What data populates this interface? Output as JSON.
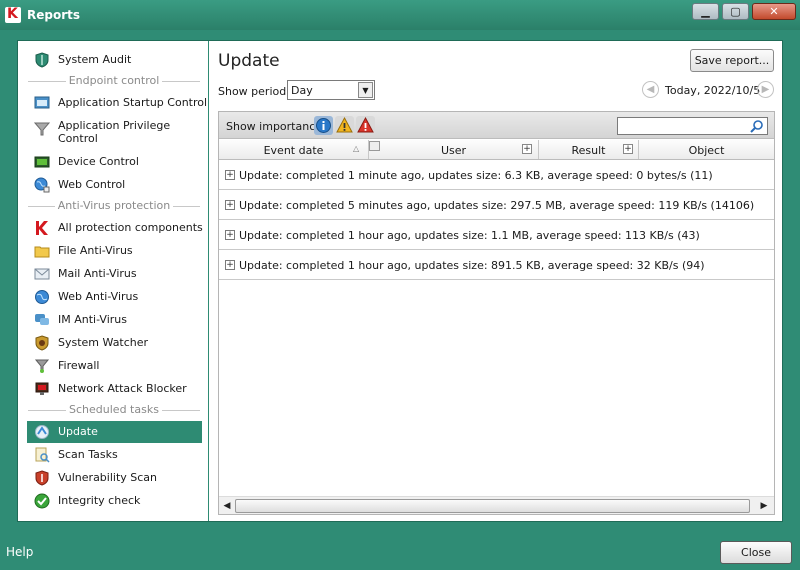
{
  "window": {
    "title": "Reports",
    "controls": {
      "minimize": "▁",
      "maximize": "▢",
      "close": "✕"
    }
  },
  "sidebar": {
    "items_top": [
      {
        "label": "System Audit",
        "icon": "shield-icon"
      }
    ],
    "section_endpoint": "Endpoint control",
    "items_endpoint": [
      {
        "label": "Application Startup Control",
        "icon": "app-window-icon"
      },
      {
        "label": "Application Privilege Control",
        "icon": "funnel-icon"
      },
      {
        "label": "Device Control",
        "icon": "device-icon"
      },
      {
        "label": "Web Control",
        "icon": "globe-icon"
      }
    ],
    "section_antivirus": "Anti-Virus protection",
    "items_antivirus": [
      {
        "label": "All protection components",
        "icon": "kaspersky-icon"
      },
      {
        "label": "File Anti-Virus",
        "icon": "folder-icon"
      },
      {
        "label": "Mail Anti-Virus",
        "icon": "envelope-icon"
      },
      {
        "label": "Web Anti-Virus",
        "icon": "globe-icon"
      },
      {
        "label": "IM Anti-Virus",
        "icon": "chat-icon"
      },
      {
        "label": "System Watcher",
        "icon": "shield-watch-icon"
      },
      {
        "label": "Firewall",
        "icon": "firewall-icon"
      },
      {
        "label": "Network Attack Blocker",
        "icon": "network-icon"
      }
    ],
    "section_tasks": "Scheduled tasks",
    "items_tasks": [
      {
        "label": "Update",
        "icon": "update-icon",
        "selected": true
      },
      {
        "label": "Scan Tasks",
        "icon": "scan-icon"
      },
      {
        "label": "Vulnerability Scan",
        "icon": "vulnerability-icon"
      },
      {
        "label": "Integrity check",
        "icon": "check-circle-icon"
      }
    ]
  },
  "main": {
    "heading": "Update",
    "save_report": "Save report...",
    "show_period_label": "Show period:",
    "period_value": "Day",
    "date_label": "Today, 2022/10/5",
    "show_importance_label": "Show importance",
    "search_placeholder": "",
    "columns": [
      "Event date",
      "User",
      "Result",
      "Object"
    ],
    "rows": [
      "Update: completed 1 minute ago, updates size: 6.3 KB, average speed: 0 bytes/s (11)",
      "Update: completed 5 minutes ago, updates size: 297.5 MB, average speed: 119 KB/s (14106)",
      "Update: completed 1 hour ago, updates size: 1.1 MB, average speed: 113 KB/s (43)",
      "Update: completed 1 hour ago, updates size: 891.5 KB, average speed: 32 KB/s (94)"
    ]
  },
  "footer": {
    "help": "Help",
    "close": "Close"
  },
  "colors": {
    "accent": "#2e8b73",
    "selected_bg": "#2e8b73",
    "brand_red": "#d4191f"
  }
}
